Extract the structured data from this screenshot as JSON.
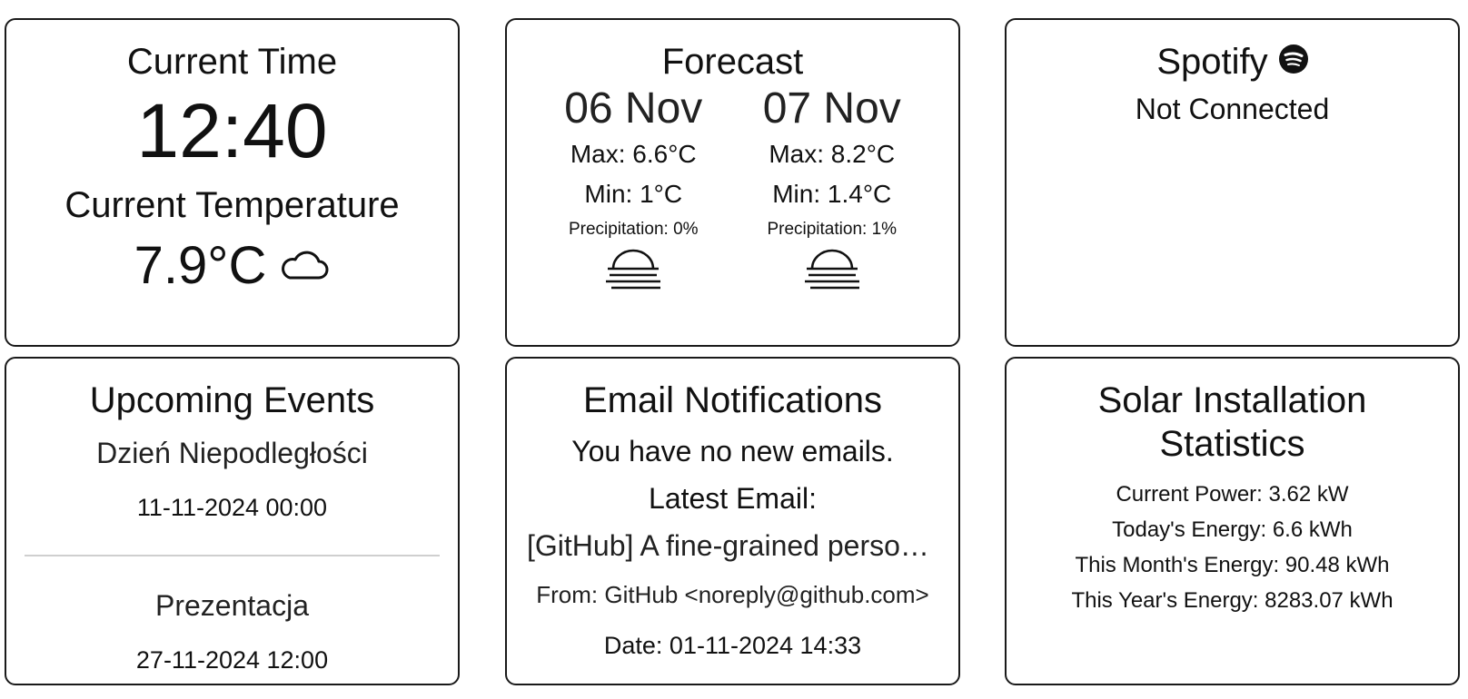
{
  "time_card": {
    "title": "Current Time",
    "time": "12:40",
    "temp_title": "Current Temperature",
    "temperature": "7.9°C",
    "weather_icon": "cloud-icon"
  },
  "forecast": {
    "title": "Forecast",
    "days": [
      {
        "date": "06 Nov",
        "max": "Max: 6.6°C",
        "min": "Min: 1°C",
        "precip": "Precipitation: 0%",
        "icon": "fog-icon"
      },
      {
        "date": "07 Nov",
        "max": "Max: 8.2°C",
        "min": "Min: 1.4°C",
        "precip": "Precipitation: 1%",
        "icon": "fog-icon"
      }
    ]
  },
  "spotify": {
    "title": "Spotify",
    "icon": "spotify-icon",
    "status": "Not Connected"
  },
  "events": {
    "title": "Upcoming Events",
    "items": [
      {
        "name": "Dzień Niepodległości",
        "date": "11-11-2024 00:00"
      },
      {
        "name": "Prezentacja",
        "date": "27-11-2024 12:00"
      }
    ]
  },
  "email": {
    "title": "Email Notifications",
    "status": "You have no new emails.",
    "latest_label": "Latest Email:",
    "subject": "[GitHub] A fine-grained personal access token has been added to your account",
    "from": "From: GitHub <noreply@github.com>",
    "date": "Date: 01-11-2024 14:33"
  },
  "solar": {
    "title": "Solar Installation Statistics",
    "current_power": "Current Power: 3.62 kW",
    "today_energy": "Today's Energy: 6.6 kWh",
    "month_energy": "This Month's Energy: 90.48 kWh",
    "year_energy": "This Year's Energy: 8283.07 kWh"
  }
}
